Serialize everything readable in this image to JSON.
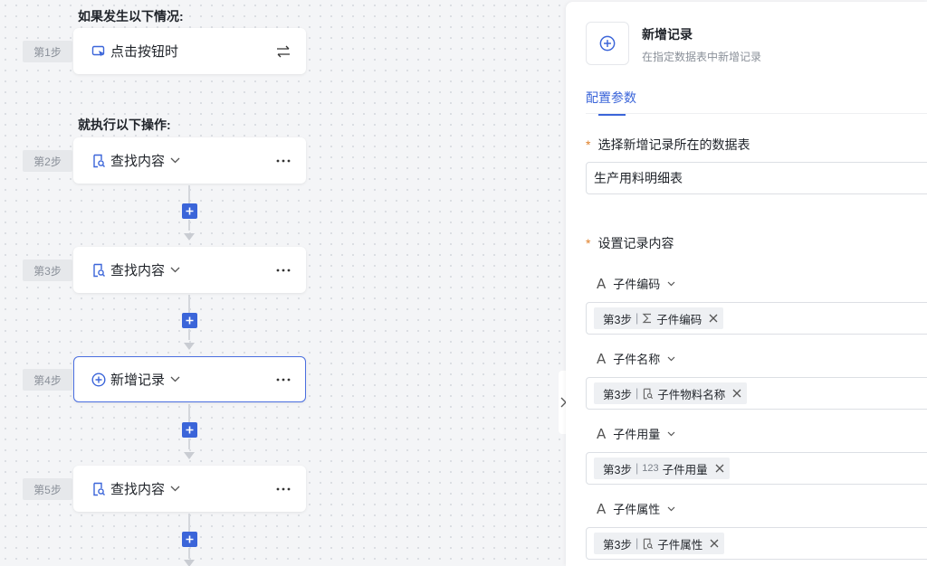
{
  "flow": {
    "trigger_heading": "如果发生以下情况:",
    "action_heading": "就执行以下操作:",
    "steps": [
      {
        "tag": "第1步",
        "label": "点击按钮时",
        "icon": "cursor-click-icon"
      },
      {
        "tag": "第2步",
        "label": "查找内容",
        "icon": "find-doc-icon"
      },
      {
        "tag": "第3步",
        "label": "查找内容",
        "icon": "find-doc-icon"
      },
      {
        "tag": "第4步",
        "label": "新增记录",
        "icon": "add-circle-icon"
      },
      {
        "tag": "第5步",
        "label": "查找内容",
        "icon": "find-doc-icon"
      }
    ]
  },
  "panel": {
    "title": "新增记录",
    "subtitle": "在指定数据表中新增记录",
    "tab": "配置参数",
    "table_label": "选择新增记录所在的数据表",
    "table_value": "生产用料明细表",
    "content_label": "设置记录内容",
    "required_mark": "*",
    "fields": [
      {
        "name": "子件编码",
        "token_step": "第3步",
        "token_icon": "sigma-icon",
        "token_text": "子件编码"
      },
      {
        "name": "子件名称",
        "token_step": "第3步",
        "token_icon": "find-doc-icon",
        "token_text": "子件物料名称"
      },
      {
        "name": "子件用量",
        "token_step": "第3步",
        "token_icon": "number-icon",
        "token_icon_text": "123",
        "token_text": "子件用量"
      },
      {
        "name": "子件属性",
        "token_step": "第3步",
        "token_icon": "find-doc-icon",
        "token_text": "子件属性"
      }
    ]
  },
  "colors": {
    "accent": "#3b65d9",
    "required": "#e0812b"
  }
}
